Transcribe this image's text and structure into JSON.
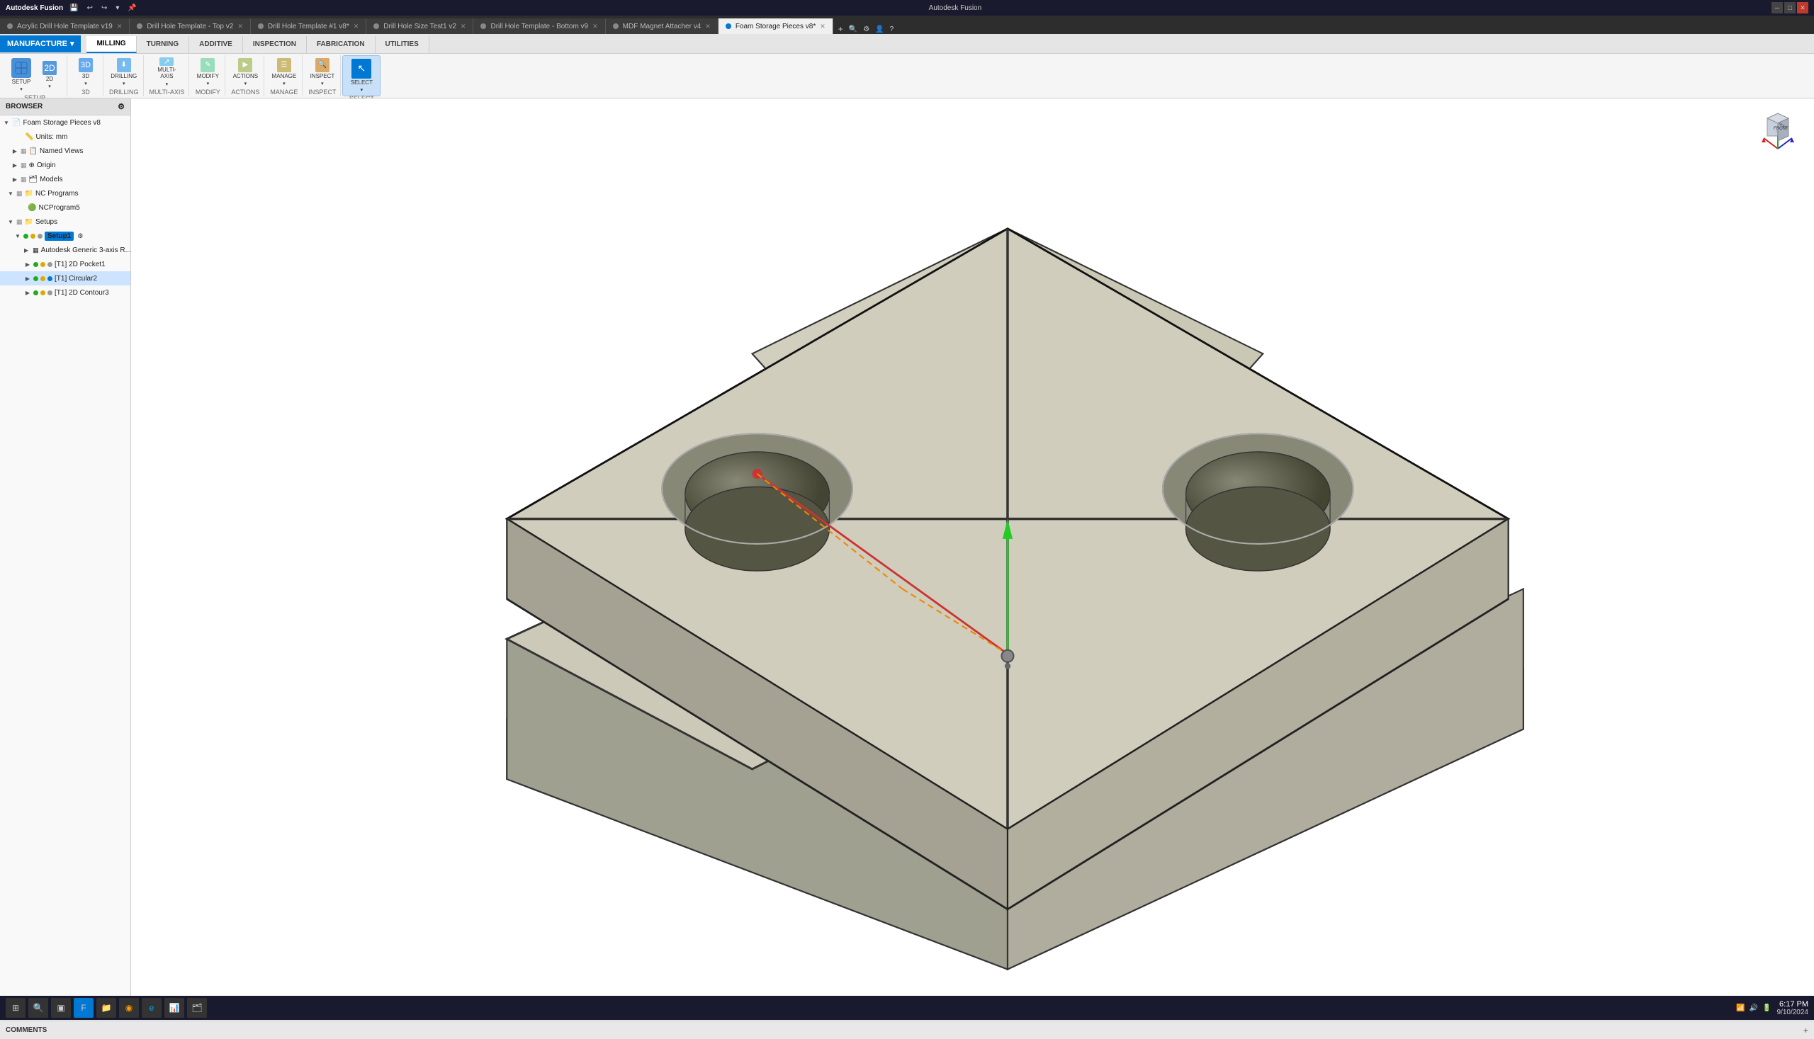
{
  "app": {
    "title": "Autodesk Fusion",
    "logo": "Autodesk Fusion"
  },
  "titlebar": {
    "controls": [
      "minimize",
      "maximize",
      "close"
    ]
  },
  "tabs": [
    {
      "label": "Acrylic Drill Hole Template v19",
      "active": false,
      "closeable": true
    },
    {
      "label": "Drill Hole Template - Top v2",
      "active": false,
      "closeable": true
    },
    {
      "label": "Drill Hole Template #1 v8*",
      "active": false,
      "closeable": true
    },
    {
      "label": "Drill Hole Size Test1 v2",
      "active": false,
      "closeable": true
    },
    {
      "label": "Drill Hole Template - Bottom v9",
      "active": false,
      "closeable": true
    },
    {
      "label": "MDF Magnet Attacher v4",
      "active": false,
      "closeable": true
    },
    {
      "label": "Foam Storage Pieces v8*",
      "active": true,
      "closeable": true
    }
  ],
  "toolbar": {
    "manufacture_label": "MANUFACTURE",
    "tabs": [
      "MILLING",
      "TURNING",
      "ADDITIVE",
      "INSPECTION",
      "FABRICATION",
      "UTILITIES"
    ],
    "active_tab": "MILLING",
    "groups": [
      {
        "label": "SETUP",
        "buttons": [
          {
            "id": "setup",
            "label": "SETUP",
            "icon": "⚙"
          },
          {
            "id": "2d",
            "label": "2D",
            "icon": "▦"
          }
        ]
      },
      {
        "label": "3D",
        "buttons": [
          {
            "id": "3d",
            "label": "3D",
            "icon": "◈"
          }
        ]
      },
      {
        "label": "DRILLING",
        "buttons": [
          {
            "id": "drilling",
            "label": "DRILLING",
            "icon": "⬇"
          }
        ]
      },
      {
        "label": "MULTI-AXIS",
        "buttons": [
          {
            "id": "multi",
            "label": "MULTI-AXIS",
            "icon": "↗"
          }
        ]
      },
      {
        "label": "MODIFY",
        "buttons": [
          {
            "id": "modify",
            "label": "MODIFY",
            "icon": "✎"
          }
        ]
      },
      {
        "label": "ACTIONS",
        "buttons": [
          {
            "id": "actions",
            "label": "ACTIONS",
            "icon": "▶"
          }
        ]
      },
      {
        "label": "MANAGE",
        "buttons": [
          {
            "id": "manage",
            "label": "MANAGE",
            "icon": "☰"
          }
        ]
      },
      {
        "label": "INSPECT",
        "buttons": [
          {
            "id": "inspect",
            "label": "INSPECT",
            "icon": "🔍"
          }
        ]
      },
      {
        "label": "SELECT",
        "buttons": [
          {
            "id": "select",
            "label": "SELECT",
            "icon": "↖"
          }
        ]
      }
    ]
  },
  "browser": {
    "header": "BROWSER",
    "tree": [
      {
        "id": "root",
        "label": "Foam Storage Pieces v8",
        "level": 0,
        "expand": true,
        "icon": "📄"
      },
      {
        "id": "units",
        "label": "Units: mm",
        "level": 1,
        "expand": false,
        "icon": "📏"
      },
      {
        "id": "named-views",
        "label": "Named Views",
        "level": 1,
        "expand": false,
        "icon": "📋"
      },
      {
        "id": "origin",
        "label": "Origin",
        "level": 1,
        "expand": false,
        "icon": "⊕"
      },
      {
        "id": "models",
        "label": "Models",
        "level": 1,
        "expand": false,
        "icon": "🗂"
      },
      {
        "id": "nc-programs",
        "label": "NC Programs",
        "level": 1,
        "expand": true,
        "icon": "📁"
      },
      {
        "id": "nc-program1",
        "label": "NCProgram5",
        "level": 2,
        "expand": false,
        "icon": "📄"
      },
      {
        "id": "setups",
        "label": "Setups",
        "level": 1,
        "expand": true,
        "icon": "📁"
      },
      {
        "id": "setup1",
        "label": "Setup1",
        "level": 2,
        "expand": true,
        "icon": "⚙",
        "badge": true
      },
      {
        "id": "machine",
        "label": "Autodesk Generic 3-axis R...",
        "level": 3,
        "expand": false,
        "icon": "🔧"
      },
      {
        "id": "pocket1",
        "label": "[T1] 2D Pocket1",
        "level": 3,
        "expand": false,
        "icon": "📄"
      },
      {
        "id": "circular2",
        "label": "[T1] Circular2",
        "level": 3,
        "expand": false,
        "icon": "📄",
        "selected": true
      },
      {
        "id": "contour3",
        "label": "[T1] 2D Contour3",
        "level": 3,
        "expand": false,
        "icon": "📄"
      }
    ]
  },
  "viewport": {
    "background_color": "#ffffff"
  },
  "bottom_toolbar": {
    "buttons": [
      "fit-view",
      "zoom-in",
      "zoom-out",
      "orbit",
      "pan",
      "display-mode",
      "materials",
      "section-analysis",
      "show-hide",
      "grid",
      "snap"
    ]
  },
  "comments": {
    "label": "COMMENTS",
    "icon": "plus"
  },
  "taskbar": {
    "time": "6:17 PM",
    "date": "9/10/2024"
  }
}
